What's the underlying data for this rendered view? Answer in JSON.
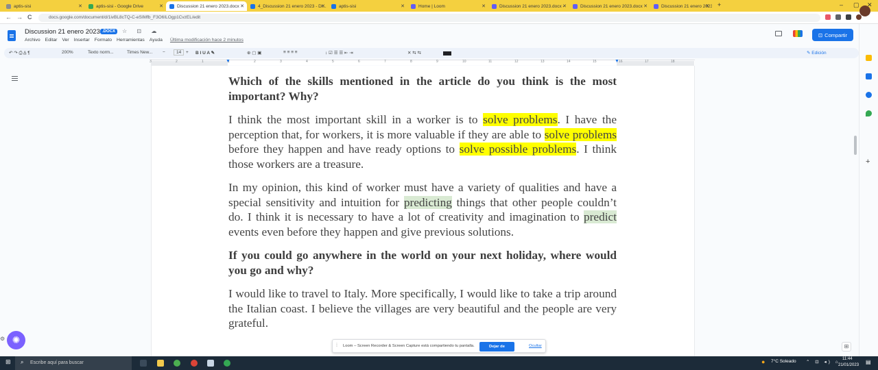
{
  "browser": {
    "tabs": [
      {
        "title": "aptis-sisi",
        "color": "#8c8c8c",
        "active": false
      },
      {
        "title": "aptis-sisi - Google Drive",
        "color": "#34a853",
        "active": false
      },
      {
        "title": "Discussion 21 enero 2023.docx",
        "color": "#1a73e8",
        "active": true
      },
      {
        "title": "4_Discussion 21 enero 2023 - Di...",
        "color": "#1a73e8",
        "active": false
      },
      {
        "title": "aptis-sisi",
        "color": "#1a73e8",
        "active": false
      },
      {
        "title": "Home | Loom",
        "color": "#625df5",
        "active": false
      },
      {
        "title": "Discussion 21 enero 2023.docx -",
        "color": "#625df5",
        "active": false
      },
      {
        "title": "Discussion 21 enero 2023.docx",
        "color": "#625df5",
        "active": false
      },
      {
        "title": "Discussion 21 enero 2023.d",
        "color": "#625df5",
        "active": false
      }
    ],
    "new_tab": "+",
    "url": "docs.google.com/document/d/1ivBL8cTQ-C-eSIMfb_F3O6ILOgp1CvzEL/edit",
    "back": "←",
    "forward": "→",
    "reload": "C"
  },
  "doc": {
    "title": "Discussion  21 enero 2023",
    "badge": ".DOCX",
    "header_icons": "☆ ⊡ ☁",
    "menus": [
      "Archivo",
      "Editar",
      "Ver",
      "Insertar",
      "Formato",
      "Herramientas",
      "Ayuda"
    ],
    "last_modified": "Última modificación hace 2 minutos",
    "share_label": "Compartir"
  },
  "toolbar": {
    "undo_redo": "↶  ↷  ⎙  A̲  ¶",
    "zoom": "200%",
    "style": "Texto norm...",
    "font": "Times New...",
    "size_minus": "−",
    "size": "14",
    "size_plus": "+",
    "format": "B  I  U  A  ✎",
    "insert": "⊕  ▢  ▣",
    "align": "≡  ≡  ≡  ≡",
    "lists": "↕  ☑  ☰  ☰  ⇤  ⇥",
    "misc": "✕  ⇆  ⇆",
    "mode": "Edición"
  },
  "ruler_marks": [
    "3",
    "2",
    "1",
    "1",
    "2",
    "3",
    "4",
    "5",
    "6",
    "7",
    "8",
    "9",
    "10",
    "11",
    "12",
    "13",
    "14",
    "15",
    "16",
    "17",
    "18"
  ],
  "content": {
    "q1": "Which of the skills mentioned in the article do you think is the most important? Why?",
    "p1": [
      {
        "text": "I think  the most important skill in a worker is to ",
        "hl": ""
      },
      {
        "text": "solve problems",
        "hl": "yellow"
      },
      {
        "text": ". I have the perception that, for workers, it is more valuable if they are able to ",
        "hl": ""
      },
      {
        "text": "solve problems",
        "hl": "yellow"
      },
      {
        "text": " before they happen and have ready options to ",
        "hl": ""
      },
      {
        "text": "solve possible problems",
        "hl": "yellow"
      },
      {
        "text": ". I think those workers are a treasure.",
        "hl": ""
      }
    ],
    "p2": [
      {
        "text": "In my opinion, this kind of worker must have a variety of qualities and have a special sensitivity and intuition for ",
        "hl": ""
      },
      {
        "text": "predicting",
        "hl": "green"
      },
      {
        "text": " things that other people couldn’t do. I think it is necessary to have a lot of creativity and imagination to ",
        "hl": ""
      },
      {
        "text": "predict",
        "hl": "green"
      },
      {
        "text": " events even before they happen and give previous solutions.",
        "hl": ""
      }
    ],
    "q2": "If you could go anywhere in the world on your next holiday, where would you go and why?",
    "p3": "I would like to travel to Italy. More specifically, I would like to take a trip around the Italian coast. I believe the villages are very beautiful and the people are very grateful."
  },
  "loom": {
    "message": "Loom – Screen Recorder & Screen Capture está compartiendo tu pantalla.",
    "stop_label": "Dejar de compartir",
    "hide_label": "Ocultar"
  },
  "taskbar": {
    "search_placeholder": "Escribe aquí para buscar",
    "weather": "7°C  Soleado",
    "time": "11:44",
    "date": "21/01/2023"
  }
}
